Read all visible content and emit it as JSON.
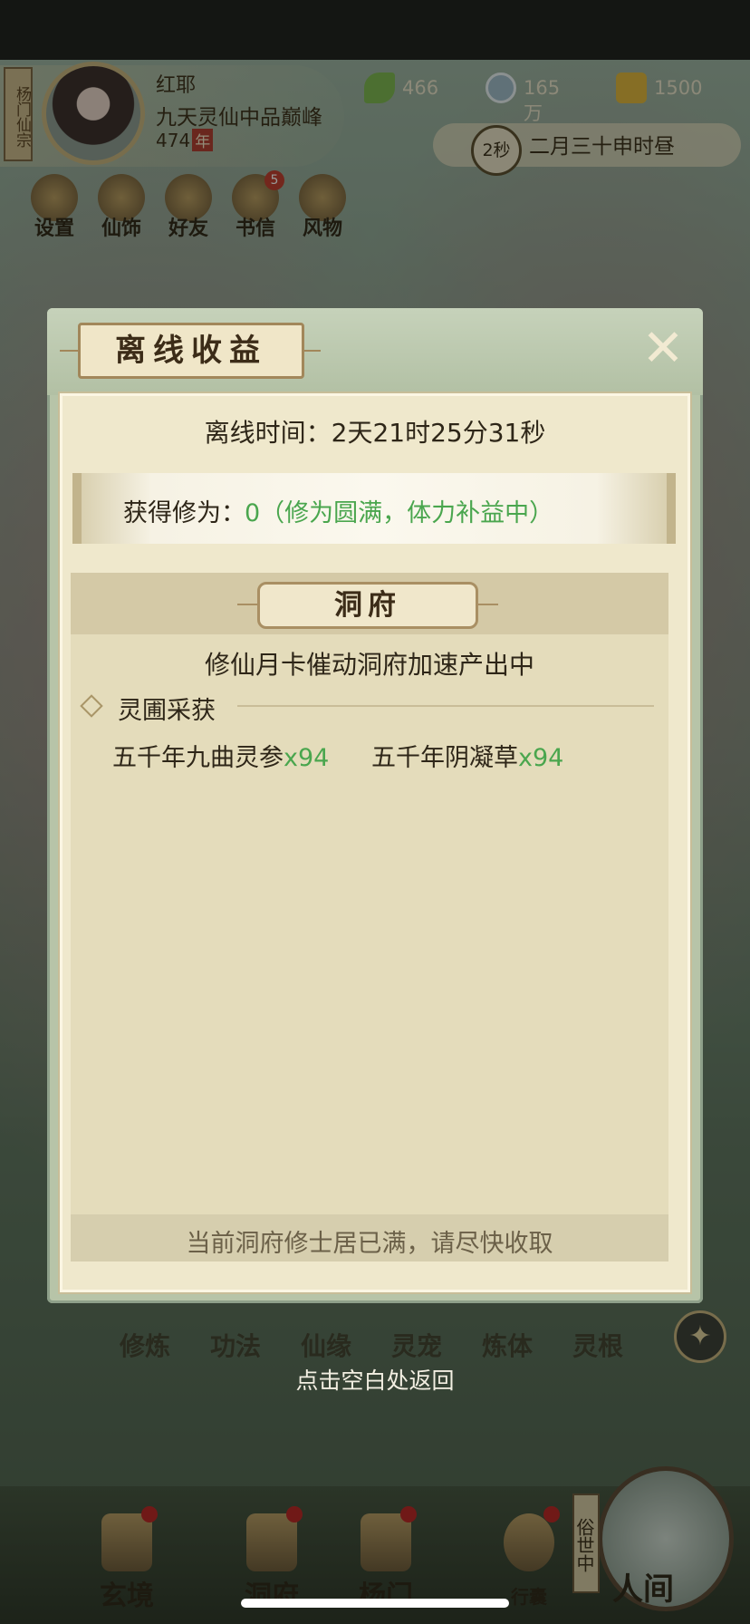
{
  "player": {
    "sect": "杨门仙宗",
    "name": "红耶",
    "rank": "九天灵仙中品巅峰",
    "age": "474",
    "age_unit": "年"
  },
  "resources": {
    "jade": "466",
    "coins": "165万",
    "gold": "1500"
  },
  "clock": {
    "countdown": "2秒",
    "time_label": "二月三十申时昼"
  },
  "quick_menu": [
    {
      "label": "设置"
    },
    {
      "label": "仙饰"
    },
    {
      "label": "好友"
    },
    {
      "label": "书信",
      "badge": "5"
    },
    {
      "label": "风物"
    }
  ],
  "modal": {
    "title": "离线收益",
    "offline_time": "离线时间：2天21时25分31秒",
    "gain_label": "获得修为：",
    "gain_value": "0（修为圆满，体力补益中）",
    "section_title": "洞府",
    "section_status": "修仙月卡催动洞府加速产出中",
    "sub_title": "灵圃采获",
    "harvest": [
      {
        "name": "五千年九曲灵参",
        "qty": "x94"
      },
      {
        "name": "五千年阴凝草",
        "qty": "x94"
      }
    ],
    "footer_note": "当前洞府修士居已满，请尽快收取"
  },
  "mid_menu": [
    "修炼",
    "功法",
    "仙缘",
    "灵宠",
    "炼体",
    "灵根"
  ],
  "return_hint": "点击空白处返回",
  "bottom_nav": [
    {
      "label": "玄境"
    },
    {
      "label": "洞府"
    },
    {
      "label": "杨门"
    },
    {
      "label": "行囊"
    }
  ],
  "world": {
    "tag": "俗世中",
    "label": "人间"
  },
  "colors": {
    "accent_green": "#4aa64e",
    "badge_red": "#c0392b",
    "panel_bg": "#efe8cc"
  }
}
